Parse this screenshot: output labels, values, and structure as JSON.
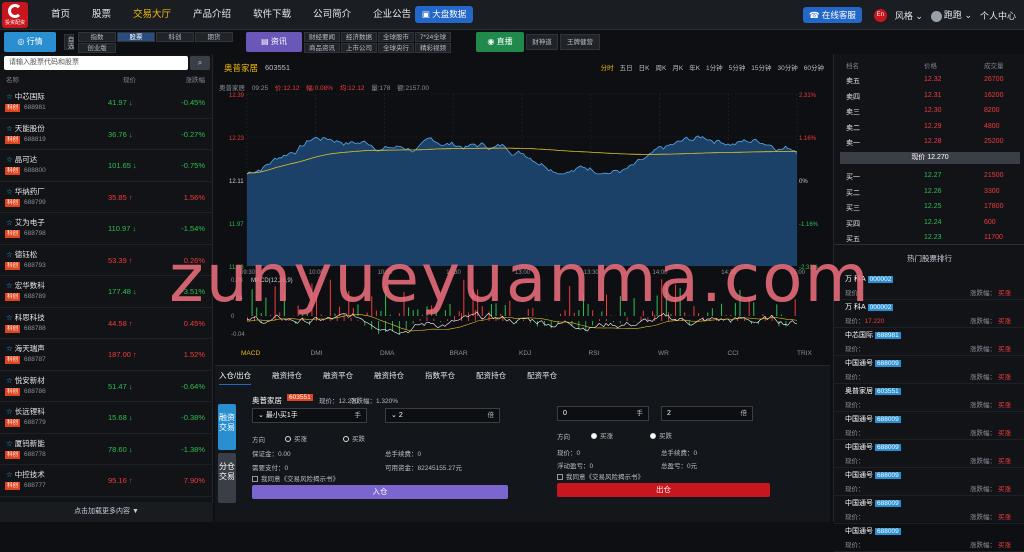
{
  "logo": {
    "text": "投资配资"
  },
  "nav": [
    {
      "label": "首页",
      "active": false
    },
    {
      "label": "股票",
      "active": false
    },
    {
      "label": "交易大厅",
      "active": true
    },
    {
      "label": "产品介绍",
      "active": false
    },
    {
      "label": "软件下载",
      "active": false
    },
    {
      "label": "公司简介",
      "active": false
    },
    {
      "label": "企业公告",
      "active": false
    }
  ],
  "bigdata_label": "大盘数据",
  "top_right": {
    "service": "在线客服",
    "lang": "En",
    "style": "风格",
    "user": "跑跑",
    "center": "个人中心"
  },
  "subbar": {
    "market_pill": "行情",
    "market_all": "自选",
    "index": "指数",
    "stocks": "股票",
    "kechuang": "科创",
    "futures": "期货",
    "chuangye": "创业版",
    "news_pill": "资讯",
    "news_links": [
      "财经要闻",
      "经济数据",
      "全球股市",
      "7*24全球",
      "商品资讯",
      "上市公司",
      "全球央行",
      "精彩视频"
    ],
    "live_pill": "直播",
    "live_links": [
      "财神道",
      "王牌健营"
    ]
  },
  "left": {
    "search_placeholder": "请输入股票代码和股票",
    "head": {
      "name": "名称",
      "price": "现价",
      "change": "涨跌幅"
    },
    "tag": "科创",
    "stocks": [
      {
        "name": "中芯国际",
        "code": "688981",
        "price": "41.97 ↓",
        "pct": "-0.45%",
        "dir": "dn"
      },
      {
        "name": "天能股份",
        "code": "688819",
        "price": "36.76 ↓",
        "pct": "-0.27%",
        "dir": "dn"
      },
      {
        "name": "晶可达",
        "code": "688800",
        "price": "101.65 ↓",
        "pct": "-0.75%",
        "dir": "dn"
      },
      {
        "name": "华纳药厂",
        "code": "688799",
        "price": "35.85 ↑",
        "pct": "1.56%",
        "dir": "up"
      },
      {
        "name": "艾为电子",
        "code": "688798",
        "price": "110.97 ↓",
        "pct": "-1.54%",
        "dir": "dn"
      },
      {
        "name": "德钰松",
        "code": "688793",
        "price": "53.39 ↑",
        "pct": "0.26%",
        "dir": "up"
      },
      {
        "name": "宏华数科",
        "code": "688789",
        "price": "177.48 ↓",
        "pct": "-3.51%",
        "dir": "dn"
      },
      {
        "name": "科思科技",
        "code": "688788",
        "price": "44.58 ↑",
        "pct": "0.45%",
        "dir": "up"
      },
      {
        "name": "海天瑞声",
        "code": "688787",
        "price": "187.00 ↑",
        "pct": "1.52%",
        "dir": "up"
      },
      {
        "name": "悦安新材",
        "code": "688786",
        "price": "51.47 ↓",
        "pct": "-0.64%",
        "dir": "dn"
      },
      {
        "name": "长远锂科",
        "code": "688779",
        "price": "15.68 ↓",
        "pct": "-0.38%",
        "dir": "dn"
      },
      {
        "name": "厦钨新能",
        "code": "688778",
        "price": "78.60 ↓",
        "pct": "-1.38%",
        "dir": "dn"
      },
      {
        "name": "中控技术",
        "code": "688777",
        "price": "95.16 ↑",
        "pct": "7.90%",
        "dir": "up"
      }
    ],
    "load_more": "点击加载更多内容 ▼"
  },
  "chart": {
    "stock_name": "奥普家居",
    "stock_code": "603551",
    "periods": [
      "分时",
      "五日",
      "日K",
      "周K",
      "月K",
      "年K",
      "1分钟",
      "5分钟",
      "15分钟",
      "30分钟",
      "60分钟"
    ],
    "active_period": "分时",
    "info": {
      "name": "奥普家居",
      "time": "09:25",
      "price": "价:12.12",
      "chg": "幅:0.08%",
      "avg": "均:12.12",
      "vol": "量:178",
      "amt": "额:2157.00"
    },
    "price_ticks": [
      "12.39",
      "12.23",
      "12.11",
      "11.97",
      "11.83"
    ],
    "pct_ticks": [
      "2.31%",
      "1.16%",
      "0%",
      "-1.16%",
      "-2.31%"
    ],
    "time_ticks": [
      "09:30",
      "10:00",
      "10:30",
      "11:30",
      "13:00",
      "13:30",
      "14:00",
      "14:30",
      "15:00"
    ],
    "macd_label": "MACD(12,26,9)",
    "macd_ticks": [
      "0.08",
      "0.04",
      "0",
      "-0.04"
    ],
    "indicator_tabs": [
      "MACD",
      "DMI",
      "DMA",
      "BRAR",
      "KDJ",
      "RSI",
      "WR",
      "CCI",
      "TRIX"
    ],
    "active_indicator": "MACD"
  },
  "trade": {
    "tabs": [
      "入仓/出仓",
      "融资持仓",
      "融资平仓",
      "融资持仓",
      "指数平仓",
      "配资持仓",
      "配资平仓"
    ],
    "side_buy": "融资交易",
    "side_sell": "分仓交易",
    "stock_name": "奥普家居",
    "stock_code": "603551",
    "price_text": "现价：12.270",
    "change_text": "涨跌幅：1.320%",
    "qty_mode": "最小买1手",
    "unit_shou": "手",
    "lever_value": "2",
    "unit_bei": "倍",
    "direction_label": "方向",
    "buy_up": "买涨",
    "buy_down": "买跌",
    "margin_label": "保证金：",
    "margin_value": "0.00",
    "fee_label": "总手续费：",
    "fee_value": "0",
    "interest_label": "需要支付：",
    "interest_value": "0",
    "available_label": "可用资金：",
    "available_value": "82245155.27元",
    "agree_text": "我同意《交易风险揭示书》",
    "enter_btn": "入仓",
    "right_qty": "0",
    "right_lever": "2",
    "price_label": "现价：",
    "price_value": "0",
    "float_label": "浮动盈亏：",
    "float_value": "0",
    "total_fee_label": "总手续费：",
    "total_fee_value": "0",
    "total_pl_label": "总盈亏：",
    "total_pl_value": "0元",
    "exit_btn": "出仓"
  },
  "right": {
    "head": {
      "name": "档名",
      "price": "价格",
      "vol": "成交量"
    },
    "asks": [
      {
        "label": "卖五",
        "price": "12.32",
        "vol": "26700"
      },
      {
        "label": "卖四",
        "price": "12.31",
        "vol": "16200"
      },
      {
        "label": "卖三",
        "price": "12.30",
        "vol": "8200"
      },
      {
        "label": "卖二",
        "price": "12.29",
        "vol": "4800"
      },
      {
        "label": "卖一",
        "price": "12.28",
        "vol": "25200"
      }
    ],
    "now_price": "现价 12.270",
    "bids": [
      {
        "label": "买一",
        "price": "12.27",
        "vol": "21500"
      },
      {
        "label": "买二",
        "price": "12.26",
        "vol": "3300"
      },
      {
        "label": "买三",
        "price": "12.25",
        "vol": "17800"
      },
      {
        "label": "买四",
        "price": "12.24",
        "vol": "600"
      },
      {
        "label": "买五",
        "price": "12.23",
        "vol": "11700"
      }
    ],
    "hot_title": "热门股票排行",
    "hot_price_label": "现价：",
    "hot_change_label": "涨跌幅：",
    "hot_action": "买涨",
    "hot": [
      {
        "name": "万 科A",
        "code": "000002",
        "price": ""
      },
      {
        "name": "万 科A",
        "code": "000002",
        "price": "17.220"
      },
      {
        "name": "中芯国际",
        "code": "688981",
        "price": ""
      },
      {
        "name": "中国通号",
        "code": "688009",
        "price": ""
      },
      {
        "name": "奥普家居",
        "code": "603551",
        "price": ""
      },
      {
        "name": "中国通号",
        "code": "688009",
        "price": ""
      },
      {
        "name": "中国通号",
        "code": "688009",
        "price": ""
      },
      {
        "name": "中国通号",
        "code": "688009",
        "price": ""
      },
      {
        "name": "中国通号",
        "code": "688009",
        "price": ""
      },
      {
        "name": "中国通号",
        "code": "688009",
        "price": ""
      }
    ]
  },
  "watermark": "zunyueyuanma.com",
  "colors": {
    "up": "#f23b3b",
    "down": "#2fbf4f",
    "accent": "#2367c8",
    "gold": "#f0b90b"
  }
}
